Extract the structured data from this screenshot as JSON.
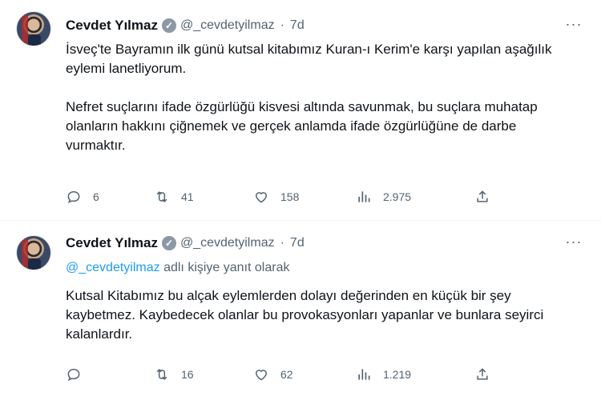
{
  "tweets": [
    {
      "author": {
        "name": "Cevdet Yılmaz",
        "handle": "@_cevdetyilmaz",
        "separator": "·",
        "time": "7d"
      },
      "paragraphs": [
        "İsveç'te Bayramın ilk günü kutsal kitabımız Kuran-ı Kerim'e karşı yapılan aşağılık eylemi lanetliyorum.",
        "Nefret suçlarını ifade özgürlüğü kisvesi altında savunmak, bu suçlara muhatap olanların hakkını çiğnemek ve gerçek anlamda ifade özgürlüğüne de darbe vurmaktır."
      ],
      "stats": {
        "replies": "6",
        "retweets": "41",
        "likes": "158",
        "views": "2.975"
      }
    },
    {
      "author": {
        "name": "Cevdet Yılmaz",
        "handle": "@_cevdetyilmaz",
        "separator": "·",
        "time": "7d"
      },
      "reply_to": {
        "handle": "@_cevdetyilmaz",
        "suffix": "adlı kişiye yanıt olarak"
      },
      "paragraphs": [
        "Kutsal Kitabımız bu alçak eylemlerden dolayı değerinden en küçük bir şey kaybetmez. Kaybedecek olanlar bu provokasyonları yapanlar ve bunlara seyirci kalanlardır."
      ],
      "stats": {
        "replies": "",
        "retweets": "16",
        "likes": "62",
        "views": "1.219"
      }
    }
  ],
  "icons": {
    "verified_mark": "✓",
    "more": "···"
  },
  "colors": {
    "text": "#0f1419",
    "muted": "#536471",
    "link": "#1d9bf0",
    "thread_line": "#cfd9de",
    "divider": "#eff3f4"
  }
}
